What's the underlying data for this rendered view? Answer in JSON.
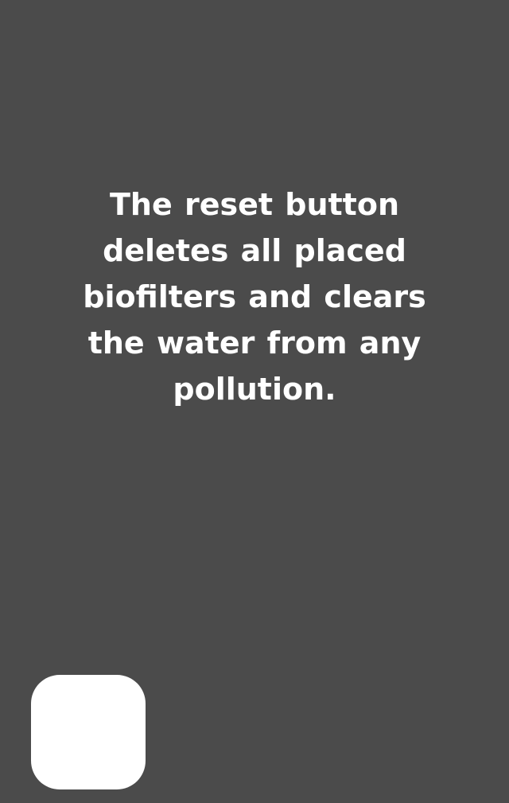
{
  "tutorial": {
    "message": "The reset button deletes all placed biofilters and clears the water from any pollution."
  },
  "colors": {
    "background": "#4b4b4b",
    "text": "#ffffff",
    "button": "#ffffff"
  },
  "reset_button": {
    "icon": "rounded-square-button"
  }
}
